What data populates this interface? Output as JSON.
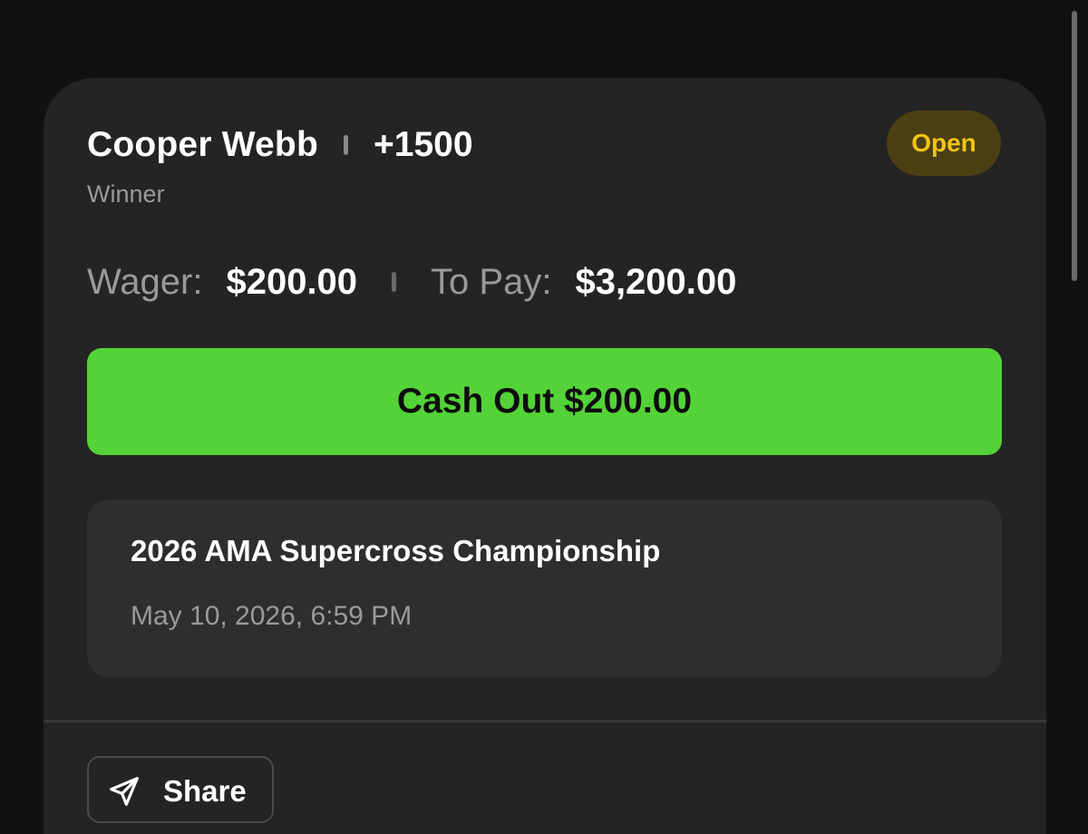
{
  "bet": {
    "selection": "Cooper Webb",
    "odds": "+1500",
    "market": "Winner",
    "status": "Open"
  },
  "amounts": {
    "wager_label": "Wager:",
    "wager_value": "$200.00",
    "to_pay_label": "To Pay:",
    "to_pay_value": "$3,200.00"
  },
  "cashout": {
    "label": "Cash Out $200.00"
  },
  "event": {
    "name": "2026 AMA Supercross Championship",
    "datetime": "May 10, 2026, 6:59 PM"
  },
  "actions": {
    "share_label": "Share",
    "share_icon": "send-icon"
  },
  "colors": {
    "accent_green": "#53d337",
    "status_yellow": "#f2c512",
    "status_bg": "#4a3f13",
    "card_bg": "#242424",
    "page_bg": "#111111"
  }
}
